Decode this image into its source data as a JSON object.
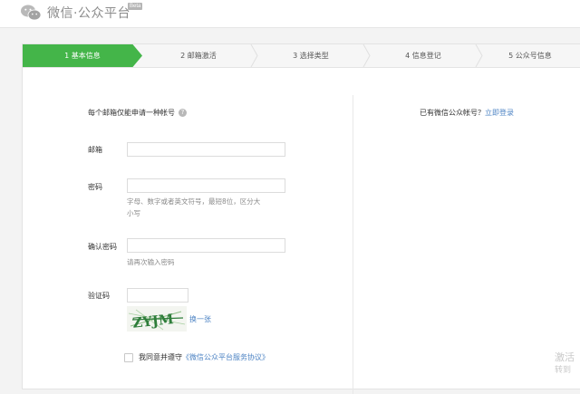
{
  "header": {
    "logo_text": "微信·公众平台",
    "beta": "Beta"
  },
  "steps": [
    {
      "label": "1 基本信息",
      "active": true
    },
    {
      "label": "2 邮箱激活",
      "active": false
    },
    {
      "label": "3 选择类型",
      "active": false
    },
    {
      "label": "4 信息登记",
      "active": false
    },
    {
      "label": "5 公众号信息",
      "active": false
    }
  ],
  "form": {
    "tip": "每个邮箱仅能申请一种帐号",
    "email_label": "邮箱",
    "email_value": "",
    "password_label": "密码",
    "password_value": "",
    "password_hint": "字母、数字或者英文符号，最短8位，区分大小写",
    "confirm_label": "确认密码",
    "confirm_value": "",
    "confirm_hint": "请再次输入密码",
    "captcha_label": "验证码",
    "captcha_value": "",
    "captcha_text": "ZYJM",
    "swap_link": "换一张",
    "agree_text": "我同意并遵守",
    "agreement_link": "《微信公众平台服务协议》"
  },
  "right": {
    "have_account": "已有微信公众帐号？",
    "login_link": "立即登录"
  },
  "watermark": {
    "line1": "激活",
    "line2": "转到"
  },
  "colors": {
    "accent": "#44b549",
    "link": "#4e84c4"
  }
}
